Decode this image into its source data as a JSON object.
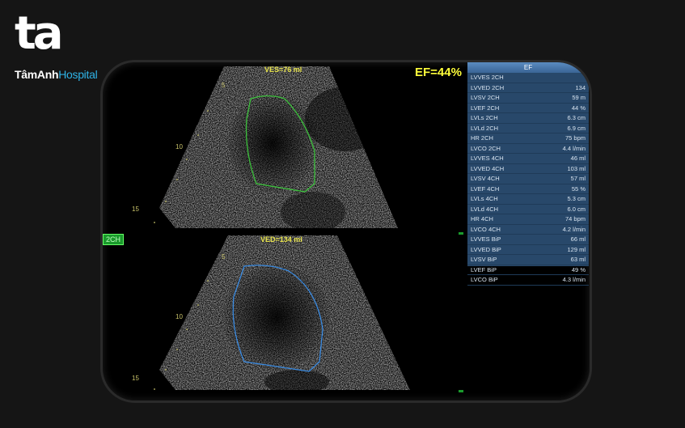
{
  "logo": {
    "mark": "ta",
    "brand": "TâmAnh",
    "hospital": "Hospital"
  },
  "image": {
    "ves_label": "VES=76 ml",
    "ved_label": "VED=134 ml",
    "ef_label": "EF=44%",
    "mode_label": "2CH",
    "depth_top": [
      "5",
      "10",
      "15"
    ],
    "depth_bottom": [
      "5",
      "10",
      "15"
    ]
  },
  "table": {
    "header": "EF",
    "header_sub": "E",
    "rows": [
      {
        "label": "LVVES 2CH",
        "value": ""
      },
      {
        "label": "LVVED 2CH",
        "value": "134"
      },
      {
        "label": "LVSV 2CH",
        "value": "59 m"
      },
      {
        "label": "LVEF 2CH",
        "value": "44 %"
      },
      {
        "label": "LVLs 2CH",
        "value": "6.3 cm"
      },
      {
        "label": "LVLd 2CH",
        "value": "6.9 cm"
      },
      {
        "label": "HR 2CH",
        "value": "75 bpm"
      },
      {
        "label": "LVCO 2CH",
        "value": "4.4 l/min"
      },
      {
        "label": "LVVES 4CH",
        "value": "46 ml"
      },
      {
        "label": "LVVED 4CH",
        "value": "103 ml"
      },
      {
        "label": "LVSV 4CH",
        "value": "57 ml"
      },
      {
        "label": "LVEF 4CH",
        "value": "55 %"
      },
      {
        "label": "LVLs 4CH",
        "value": "5.3 cm"
      },
      {
        "label": "LVLd 4CH",
        "value": "6.0 cm"
      },
      {
        "label": "HR 4CH",
        "value": "74 bpm"
      },
      {
        "label": "LVCO 4CH",
        "value": "4.2 l/min"
      },
      {
        "label": "LVVES BiP",
        "value": "66 ml"
      },
      {
        "label": "LVVED BiP",
        "value": "129 ml"
      },
      {
        "label": "LVSV BiP",
        "value": "63 ml"
      },
      {
        "label": "LVEF BiP",
        "value": "49 %"
      },
      {
        "label": "LVCO BiP",
        "value": "4.3 l/min"
      }
    ]
  },
  "colors": {
    "systole_contour": "#3cc03c",
    "diastole_contour": "#3a8ae0",
    "ef_text": "#ffff3a",
    "table_bg": "#28486a"
  }
}
